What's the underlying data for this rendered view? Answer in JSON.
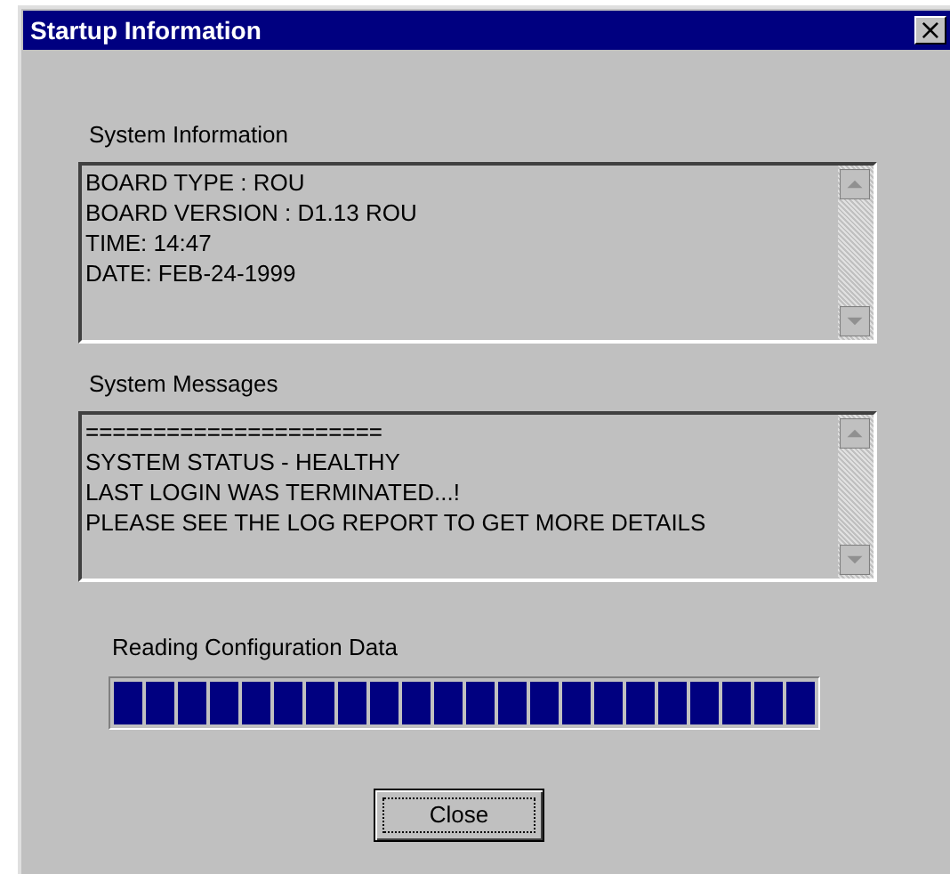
{
  "window": {
    "title": "Startup Information",
    "close_glyph": "×"
  },
  "panels": [
    {
      "label": "System Information",
      "lines": [
        "BOARD TYPE : ROU",
        "BOARD VERSION : D1.13 ROU",
        "TIME: 14:47",
        "DATE: FEB-24-1999"
      ]
    },
    {
      "label": "System Messages",
      "lines": [
        "======================",
        "SYSTEM STATUS - HEALTHY",
        "LAST LOGIN WAS TERMINATED...!",
        "PLEASE SEE THE LOG REPORT TO GET MORE DETAILS"
      ]
    }
  ],
  "progress": {
    "label": "Reading Configuration Data",
    "level": 1.0
  },
  "buttons": [
    "Close"
  ]
}
